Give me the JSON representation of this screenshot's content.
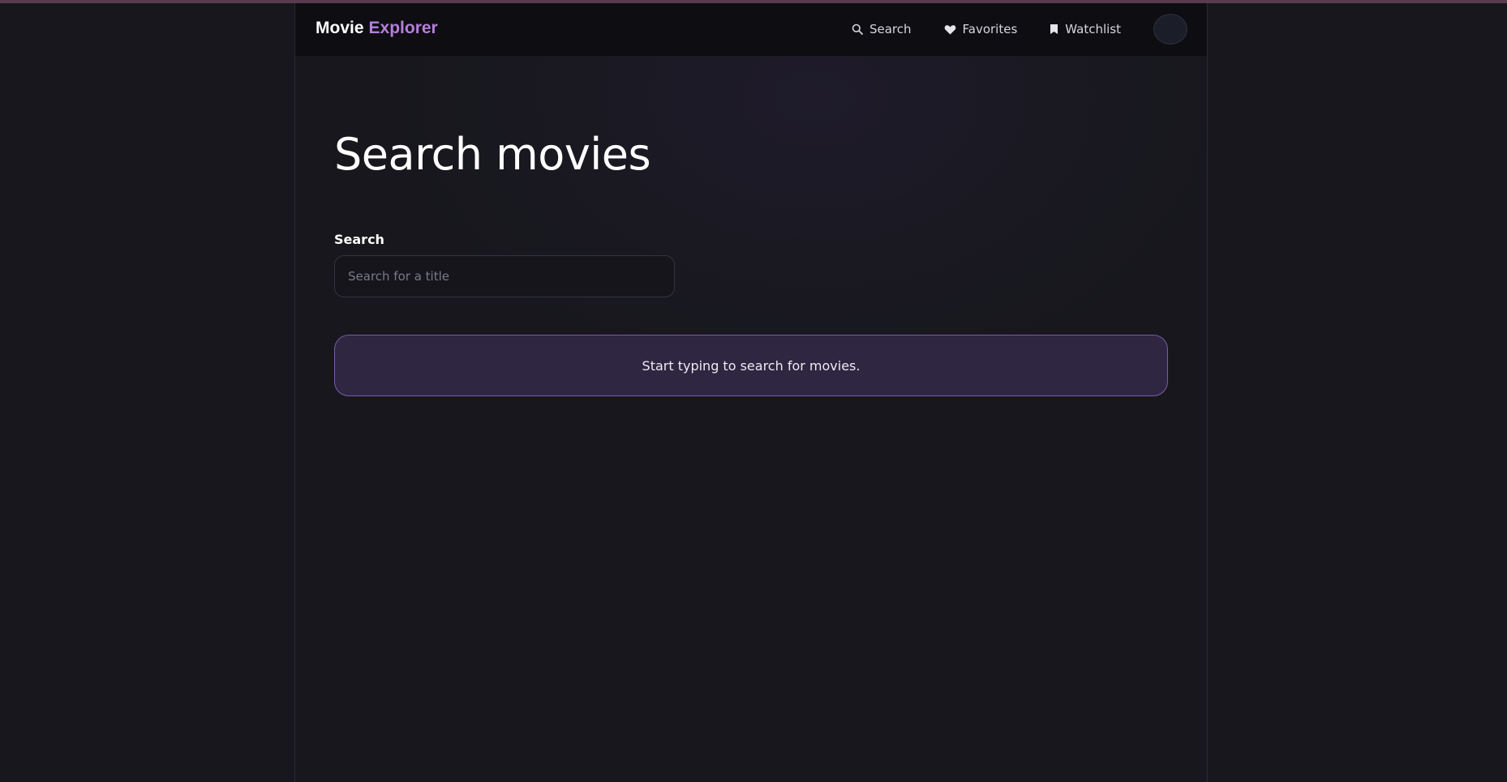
{
  "brand": {
    "first": "Movie",
    "accent": "Explorer"
  },
  "nav": {
    "items": [
      {
        "label": "Search",
        "icon": "search-icon"
      },
      {
        "label": "Favorites",
        "icon": "heart-icon"
      },
      {
        "label": "Watchlist",
        "icon": "bookmark-icon"
      }
    ]
  },
  "page": {
    "title": "Search movies"
  },
  "search": {
    "label": "Search",
    "placeholder": "Search for a title",
    "value": ""
  },
  "empty_state": {
    "message": "Start typing to search for movies."
  },
  "colors": {
    "background": "#17171d",
    "navbar": "#0d0d12",
    "accent": "#b57edc",
    "empty_state_bg": "#2f2642",
    "empty_state_border": "#7a5ca3"
  }
}
